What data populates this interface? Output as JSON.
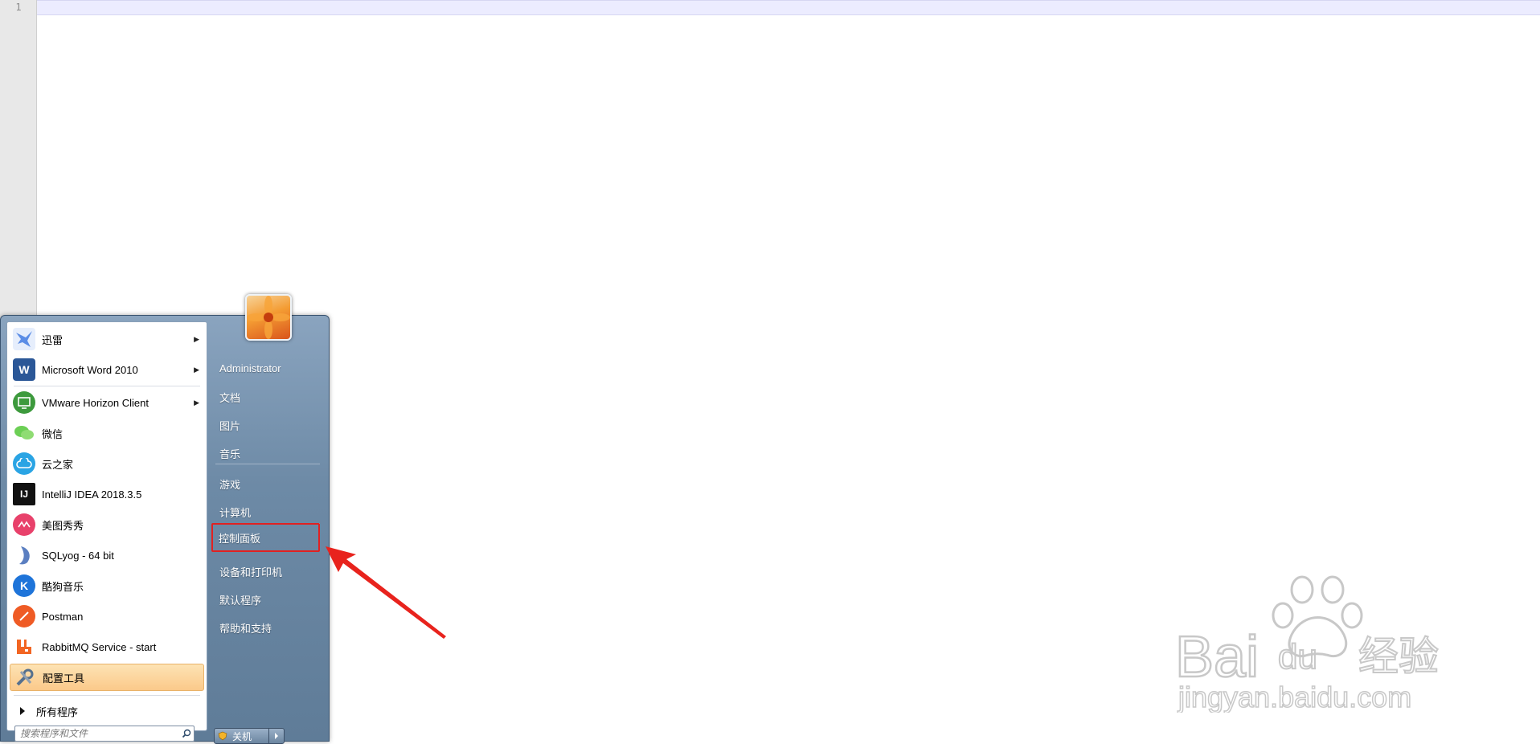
{
  "editor": {
    "line_number": "1"
  },
  "start_menu": {
    "programs": [
      {
        "label": "迅雷",
        "icon": "thunder-bird-icon",
        "has_submenu": true,
        "color": "#7aa3e8"
      },
      {
        "label": "Microsoft Word 2010",
        "icon": "word-icon",
        "has_submenu": true,
        "color": "#2b5797"
      },
      {
        "label": "VMware Horizon Client",
        "icon": "vmware-horizon-icon",
        "has_submenu": true,
        "color": "#3d9a3d"
      },
      {
        "label": "微信",
        "icon": "wechat-icon",
        "has_submenu": false,
        "color": "#6ccf55"
      },
      {
        "label": "云之家",
        "icon": "cloud-icon",
        "has_submenu": false,
        "color": "#2aa4e4"
      },
      {
        "label": "IntelliJ IDEA 2018.3.5",
        "icon": "intellij-icon",
        "has_submenu": false,
        "color": "#111111"
      },
      {
        "label": "美图秀秀",
        "icon": "meitu-icon",
        "has_submenu": false,
        "color": "#e8416b"
      },
      {
        "label": "SQLyog - 64 bit",
        "icon": "dolphin-icon",
        "has_submenu": false,
        "color": "#5b7fc1"
      },
      {
        "label": "酷狗音乐",
        "icon": "kugou-icon",
        "has_submenu": false,
        "color": "#1e74d9"
      },
      {
        "label": "Postman",
        "icon": "postman-icon",
        "has_submenu": false,
        "color": "#ef5b25"
      },
      {
        "label": "RabbitMQ Service - start",
        "icon": "rabbitmq-icon",
        "has_submenu": false,
        "color": "#f26522"
      },
      {
        "label": "配置工具",
        "icon": "tools-icon",
        "has_submenu": false,
        "color": "#4a6a8a"
      }
    ],
    "all_programs_label": "所有程序",
    "search_placeholder": "搜索程序和文件",
    "right_items": {
      "user": "Administrator",
      "documents": "文档",
      "pictures": "图片",
      "music": "音乐",
      "games": "游戏",
      "computer": "计算机",
      "control_panel": "控制面板",
      "devices_printers": "设备和打印机",
      "default_programs": "默认程序",
      "help_support": "帮助和支持"
    },
    "shutdown_label": "关机"
  },
  "watermark": {
    "brand": "Bai",
    "brand_tail": "du",
    "cn": "经验",
    "url": "jingyan.baidu.com"
  },
  "colors": {
    "highlight_box": "#e12121",
    "arrow": "#e8231d",
    "selected_item": "#fbc98a"
  }
}
